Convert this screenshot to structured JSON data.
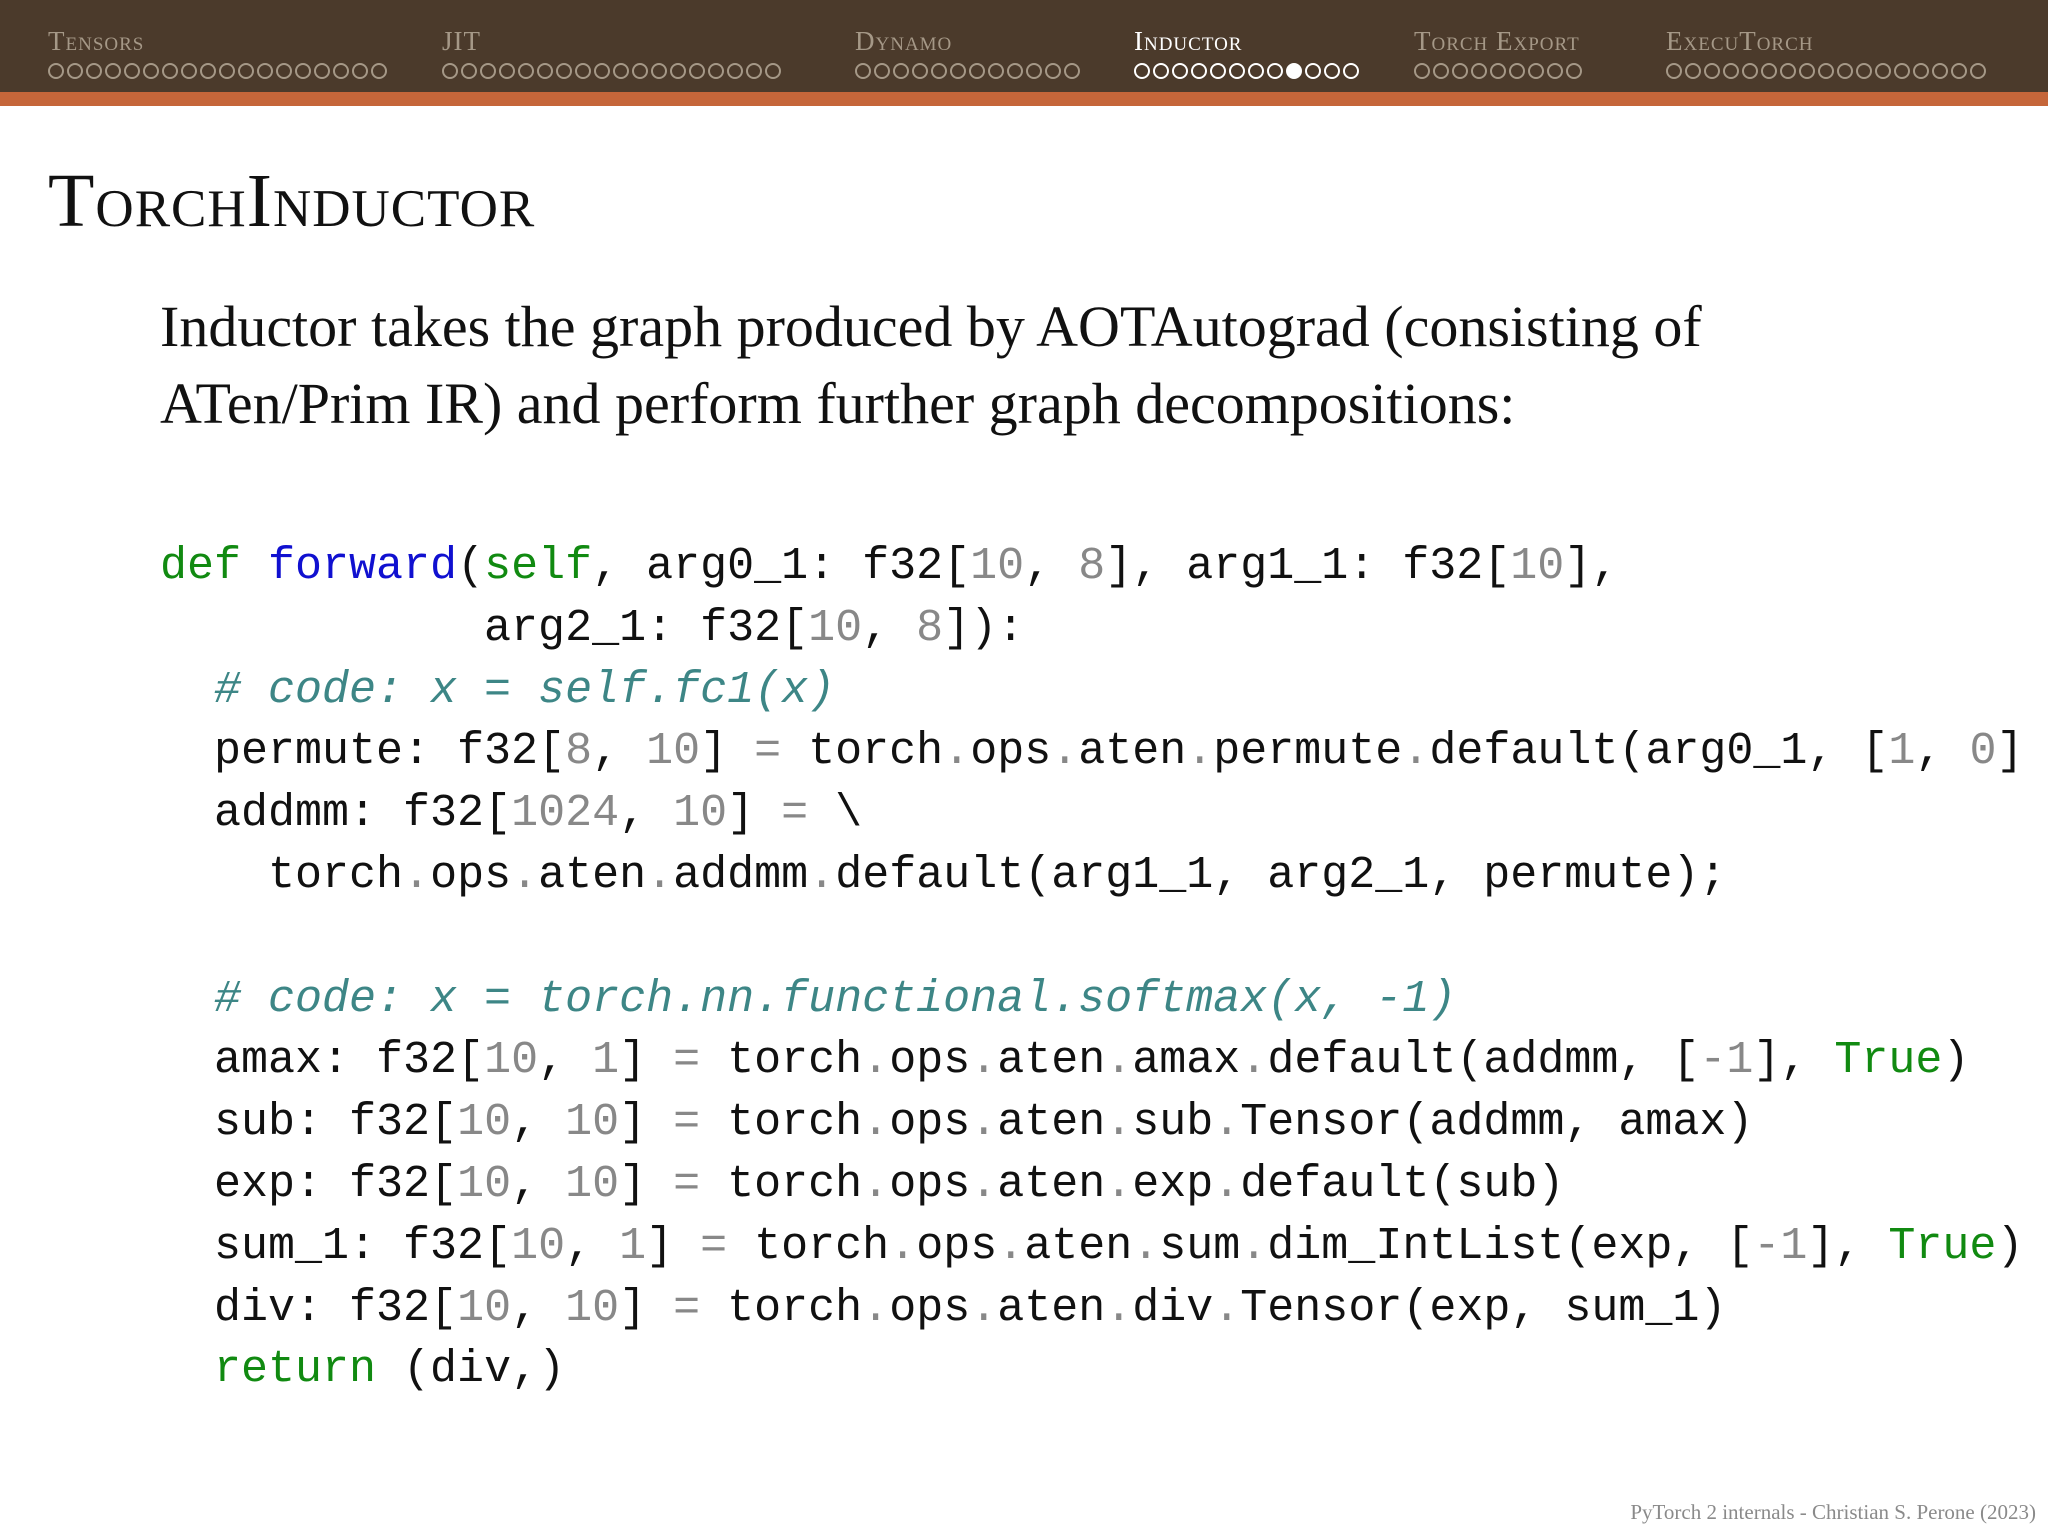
{
  "nav": {
    "sections": [
      {
        "label": "Tensors",
        "dots": 18,
        "active": false,
        "current": -1
      },
      {
        "label": "JIT",
        "dots": 18,
        "active": false,
        "current": -1
      },
      {
        "label": "Dynamo",
        "dots": 12,
        "active": false,
        "current": -1
      },
      {
        "label": "Inductor",
        "dots": 12,
        "active": true,
        "current": 8
      },
      {
        "label": "Torch Export",
        "dots": 9,
        "active": false,
        "current": -1
      },
      {
        "label": "ExecuTorch",
        "dots": 17,
        "active": false,
        "current": -1
      }
    ]
  },
  "slide": {
    "title": "TorchInductor",
    "intro_line1": "Inductor takes the graph produced by AOTAutograd (consisting of",
    "intro_line2": "ATen/Prim IR) and perform further graph decompositions:"
  },
  "code": {
    "lines": [
      [
        [
          "kw",
          "def"
        ],
        [
          "",
          " "
        ],
        [
          "fn",
          "forward"
        ],
        [
          "",
          "("
        ],
        [
          "kw",
          "self"
        ],
        [
          "",
          ", arg0_1: f32["
        ],
        [
          "num",
          "10"
        ],
        [
          "",
          ", "
        ],
        [
          "num",
          "8"
        ],
        [
          "",
          "], arg1_1: f32["
        ],
        [
          "num",
          "10"
        ],
        [
          "",
          "],"
        ]
      ],
      [
        [
          "",
          "            arg2_1: f32["
        ],
        [
          "num",
          "10"
        ],
        [
          "",
          ", "
        ],
        [
          "num",
          "8"
        ],
        [
          "",
          "]):"
        ]
      ],
      [
        [
          "",
          "  "
        ],
        [
          "cm",
          "# code: x = self.fc1(x)"
        ]
      ],
      [
        [
          "",
          "  permute: f32["
        ],
        [
          "num",
          "8"
        ],
        [
          "",
          ", "
        ],
        [
          "num",
          "10"
        ],
        [
          "",
          "] "
        ],
        [
          "dt",
          "="
        ],
        [
          "",
          " torch"
        ],
        [
          "dt",
          "."
        ],
        [
          "",
          "ops"
        ],
        [
          "dt",
          "."
        ],
        [
          "",
          "aten"
        ],
        [
          "dt",
          "."
        ],
        [
          "",
          "permute"
        ],
        [
          "dt",
          "."
        ],
        [
          "",
          "default(arg0_1, ["
        ],
        [
          "num",
          "1"
        ],
        [
          "",
          ", "
        ],
        [
          "num",
          "0"
        ],
        [
          "",
          "])"
        ]
      ],
      [
        [
          "",
          "  addmm: f32["
        ],
        [
          "num",
          "1024"
        ],
        [
          "",
          ", "
        ],
        [
          "num",
          "10"
        ],
        [
          "",
          "] "
        ],
        [
          "dt",
          "="
        ],
        [
          "",
          " \\"
        ]
      ],
      [
        [
          "",
          "    torch"
        ],
        [
          "dt",
          "."
        ],
        [
          "",
          "ops"
        ],
        [
          "dt",
          "."
        ],
        [
          "",
          "aten"
        ],
        [
          "dt",
          "."
        ],
        [
          "",
          "addmm"
        ],
        [
          "dt",
          "."
        ],
        [
          "",
          "default(arg1_1, arg2_1, permute);"
        ]
      ],
      [],
      [
        [
          "",
          "  "
        ],
        [
          "cm",
          "# code: x = torch.nn.functional.softmax(x, -1)"
        ]
      ],
      [
        [
          "",
          "  amax: f32["
        ],
        [
          "num",
          "10"
        ],
        [
          "",
          ", "
        ],
        [
          "num",
          "1"
        ],
        [
          "",
          "] "
        ],
        [
          "dt",
          "="
        ],
        [
          "",
          " torch"
        ],
        [
          "dt",
          "."
        ],
        [
          "",
          "ops"
        ],
        [
          "dt",
          "."
        ],
        [
          "",
          "aten"
        ],
        [
          "dt",
          "."
        ],
        [
          "",
          "amax"
        ],
        [
          "dt",
          "."
        ],
        [
          "",
          "default(addmm, ["
        ],
        [
          "num",
          "-1"
        ],
        [
          "",
          "], "
        ],
        [
          "kw",
          "True"
        ],
        [
          "",
          ")"
        ]
      ],
      [
        [
          "",
          "  sub: f32["
        ],
        [
          "num",
          "10"
        ],
        [
          "",
          ", "
        ],
        [
          "num",
          "10"
        ],
        [
          "",
          "] "
        ],
        [
          "dt",
          "="
        ],
        [
          "",
          " torch"
        ],
        [
          "dt",
          "."
        ],
        [
          "",
          "ops"
        ],
        [
          "dt",
          "."
        ],
        [
          "",
          "aten"
        ],
        [
          "dt",
          "."
        ],
        [
          "",
          "sub"
        ],
        [
          "dt",
          "."
        ],
        [
          "",
          "Tensor(addmm, amax)"
        ]
      ],
      [
        [
          "",
          "  exp: f32["
        ],
        [
          "num",
          "10"
        ],
        [
          "",
          ", "
        ],
        [
          "num",
          "10"
        ],
        [
          "",
          "] "
        ],
        [
          "dt",
          "="
        ],
        [
          "",
          " torch"
        ],
        [
          "dt",
          "."
        ],
        [
          "",
          "ops"
        ],
        [
          "dt",
          "."
        ],
        [
          "",
          "aten"
        ],
        [
          "dt",
          "."
        ],
        [
          "",
          "exp"
        ],
        [
          "dt",
          "."
        ],
        [
          "",
          "default(sub)"
        ]
      ],
      [
        [
          "",
          "  sum_1: f32["
        ],
        [
          "num",
          "10"
        ],
        [
          "",
          ", "
        ],
        [
          "num",
          "1"
        ],
        [
          "",
          "] "
        ],
        [
          "dt",
          "="
        ],
        [
          "",
          " torch"
        ],
        [
          "dt",
          "."
        ],
        [
          "",
          "ops"
        ],
        [
          "dt",
          "."
        ],
        [
          "",
          "aten"
        ],
        [
          "dt",
          "."
        ],
        [
          "",
          "sum"
        ],
        [
          "dt",
          "."
        ],
        [
          "",
          "dim_IntList(exp, ["
        ],
        [
          "num",
          "-1"
        ],
        [
          "",
          "], "
        ],
        [
          "kw",
          "True"
        ],
        [
          "",
          ")"
        ]
      ],
      [
        [
          "",
          "  div: f32["
        ],
        [
          "num",
          "10"
        ],
        [
          "",
          ", "
        ],
        [
          "num",
          "10"
        ],
        [
          "",
          "] "
        ],
        [
          "dt",
          "="
        ],
        [
          "",
          " torch"
        ],
        [
          "dt",
          "."
        ],
        [
          "",
          "ops"
        ],
        [
          "dt",
          "."
        ],
        [
          "",
          "aten"
        ],
        [
          "dt",
          "."
        ],
        [
          "",
          "div"
        ],
        [
          "dt",
          "."
        ],
        [
          "",
          "Tensor(exp, sum_1)"
        ]
      ],
      [
        [
          "",
          "  "
        ],
        [
          "kw",
          "return"
        ],
        [
          "",
          " (div,)"
        ]
      ]
    ]
  },
  "footer": {
    "text": "PyTorch 2 internals - Christian S. Perone (2023)"
  }
}
